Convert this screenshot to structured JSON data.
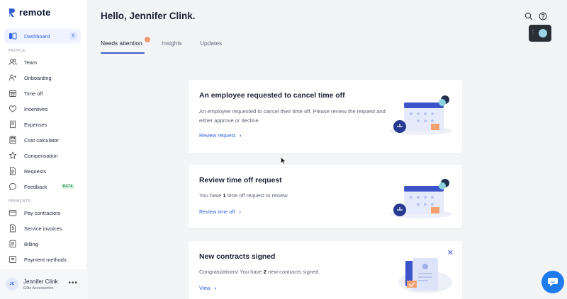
{
  "app": {
    "logo_text": "remote"
  },
  "header": {
    "greeting": "Hello, Jennifer Clink."
  },
  "sidebar": {
    "dashboard": {
      "label": "Dashboard",
      "badge": "6"
    },
    "sections": {
      "people": "PEOPLE",
      "payments": "PAYMENTS"
    },
    "people_items": [
      {
        "label": "Team",
        "icon": "users-icon"
      },
      {
        "label": "Onboarding",
        "icon": "user-plus-icon"
      },
      {
        "label": "Time off",
        "icon": "calendar-icon"
      },
      {
        "label": "Incentives",
        "icon": "heart-icon"
      },
      {
        "label": "Expenses",
        "icon": "receipt-icon"
      },
      {
        "label": "Cost calculator",
        "icon": "calculator-icon"
      },
      {
        "label": "Compensation",
        "icon": "star-icon"
      },
      {
        "label": "Requests",
        "icon": "document-icon"
      },
      {
        "label": "Feedback",
        "icon": "chat-bubble-icon",
        "badge": "BETA"
      }
    ],
    "payment_items": [
      {
        "label": "Pay contractors",
        "icon": "wallet-icon"
      },
      {
        "label": "Service invoices",
        "icon": "dollar-doc-icon"
      },
      {
        "label": "Billing",
        "icon": "bill-icon"
      },
      {
        "label": "Payment methods",
        "icon": "card-icon"
      }
    ],
    "user": {
      "initials": "JC",
      "name": "Jennifer Clink",
      "company": "Glitz Accessories",
      "menu": "•••"
    }
  },
  "tabs": [
    {
      "label": "Needs attention",
      "active": true,
      "dot": ""
    },
    {
      "label": "Insights",
      "active": false
    },
    {
      "label": "Updates",
      "active": false
    }
  ],
  "cards": [
    {
      "title": "An employee requested to cancel time off",
      "body": "An employee requested to cancel their time off. Please review the request and either approve or decline.",
      "link": "Review request"
    },
    {
      "title": "Review time off request",
      "body_pre": "You have ",
      "body_num": "1",
      "body_post": " time off request to review.",
      "link": "Review time off"
    },
    {
      "title": "New contracts signed",
      "body_pre": "Congratulations! You have ",
      "body_num": "2",
      "body_post": " new contracts signed.",
      "link": "View"
    }
  ],
  "colors": {
    "accent": "#3160e0",
    "link": "#2f5fd6",
    "chat": "#1e7bf0",
    "tab_dot": "#f19a76"
  }
}
